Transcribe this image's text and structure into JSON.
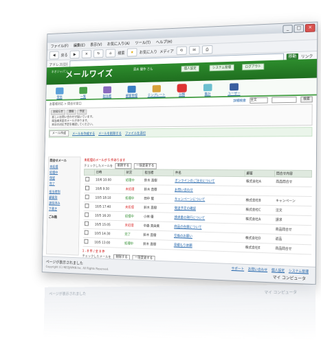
{
  "browser": {
    "title": "",
    "menu": [
      "ファイル(F)",
      "編集(E)",
      "表示(V)",
      "お気に入り(A)",
      "ツール(T)",
      "ヘルプ(H)"
    ],
    "toolbar": {
      "back": "戻る",
      "search": "検索",
      "favorites": "お気に入り",
      "media": "メディア"
    },
    "address_label": "アドレス(D)",
    "go_label": "移動",
    "links_label": "リンク"
  },
  "app": {
    "logo_small": "ネオジャパン",
    "logo_main": "メールワイズ",
    "user_info": "清水 健作 さん",
    "hdr_buttons": [
      "個人設定",
      "システム管理",
      "ログアウト"
    ]
  },
  "nav": {
    "items": [
      {
        "label": "受信",
        "color": "#5aa0d8"
      },
      {
        "label": "一覧",
        "color": "#4aa14a"
      },
      {
        "label": "担当者",
        "color": "#8a6bbf"
      },
      {
        "label": "顧客管理",
        "color": "#3b7fc4"
      },
      {
        "label": "テンプレート",
        "color": "#d8a23b"
      },
      {
        "label": "分類",
        "color": "#d33"
      },
      {
        "label": "集計",
        "color": "#6bbfcf"
      },
      {
        "label": "ユーザー",
        "color": "#3a5fa0"
      }
    ]
  },
  "crumb": "お客様対応 > 問合せ窓口",
  "search": {
    "label": "詳細検索",
    "select": "全文",
    "button": "検索"
  },
  "notice": {
    "tabs": [
      "お知らせ",
      "連絡",
      "予定"
    ],
    "lines": [
      "新しいお問い合わせが届いています。",
      "担当者未定のメールがあります。",
      "本日の対応予定を確認してください。"
    ]
  },
  "actions": {
    "button": "メール作成",
    "links": [
      "メールを作成する",
      "メールを削除する",
      "ファイルを添付"
    ]
  },
  "sidebar": {
    "head": "問合せメール",
    "items": [
      "未処理",
      "処理中",
      "保留",
      "完了",
      "担当者別",
      "顧客別",
      "送信済み",
      "下書き",
      "ゴミ箱"
    ],
    "footer": "ごみ箱"
  },
  "list": {
    "warning": "未処理のメールが 5 件あります",
    "check_label": "チェックしたメールを",
    "check_buttons": [
      "削除する",
      "一括変更する"
    ],
    "columns": [
      "",
      "日時",
      "状況",
      "担当者",
      "件名",
      "顧客",
      "問合せ内容"
    ],
    "rows": [
      {
        "date": "10/6 10:00",
        "status": "処理中",
        "red": false,
        "owner": "鈴木 直樹",
        "subject": "オンラインのご注文について",
        "customer": "株式会社A",
        "topic": "商品問合せ"
      },
      {
        "date": "10/6 9:30",
        "status": "未処理",
        "red": true,
        "owner": "鈴木 直樹",
        "subject": "お問い合わせ",
        "customer": "",
        "topic": ""
      },
      {
        "date": "10/5 18:10",
        "status": "処理中",
        "red": false,
        "owner": "田中 健",
        "subject": "キャンペーンについて",
        "customer": "株式会社B",
        "topic": "キャンペーン"
      },
      {
        "date": "10/5 17:40",
        "status": "未処理",
        "red": true,
        "owner": "鈴木 直樹",
        "subject": "発送予定の確認",
        "customer": "株式会社C",
        "topic": "注文"
      },
      {
        "date": "10/5 16:20",
        "status": "処理中",
        "red": false,
        "owner": "小林 優",
        "subject": "請求書の発行について",
        "customer": "株式会社A",
        "topic": "請求"
      },
      {
        "date": "10/5 15:05",
        "status": "未処理",
        "red": true,
        "owner": "中森 真由美",
        "subject": "商品の在庫について",
        "customer": "",
        "topic": "商品問合せ"
      },
      {
        "date": "10/5 14:30",
        "status": "完了",
        "red": false,
        "owner": "鈴木 直樹",
        "subject": "交換のお願い",
        "customer": "株式会社D",
        "topic": "返品"
      },
      {
        "date": "10/5 13:00",
        "status": "処理中",
        "red": false,
        "owner": "鈴木 直樹",
        "subject": "見積もり依頼",
        "customer": "株式会社E",
        "topic": "商品問合せ"
      }
    ],
    "pager": "1 - 8 件 / 全 8 件",
    "check_label2": "チェックしたメールを",
    "buttons2": [
      "削除する",
      "一括変更する"
    ]
  },
  "footer": {
    "status": "ページが表示されました",
    "links": [
      "サポート",
      "お問い合わせ",
      "個人設定",
      "システム管理"
    ],
    "copyright": "Copyright (C) NEOJAPAN Inc. All Rights Reserved.",
    "zone": "マイ コンピュータ"
  }
}
